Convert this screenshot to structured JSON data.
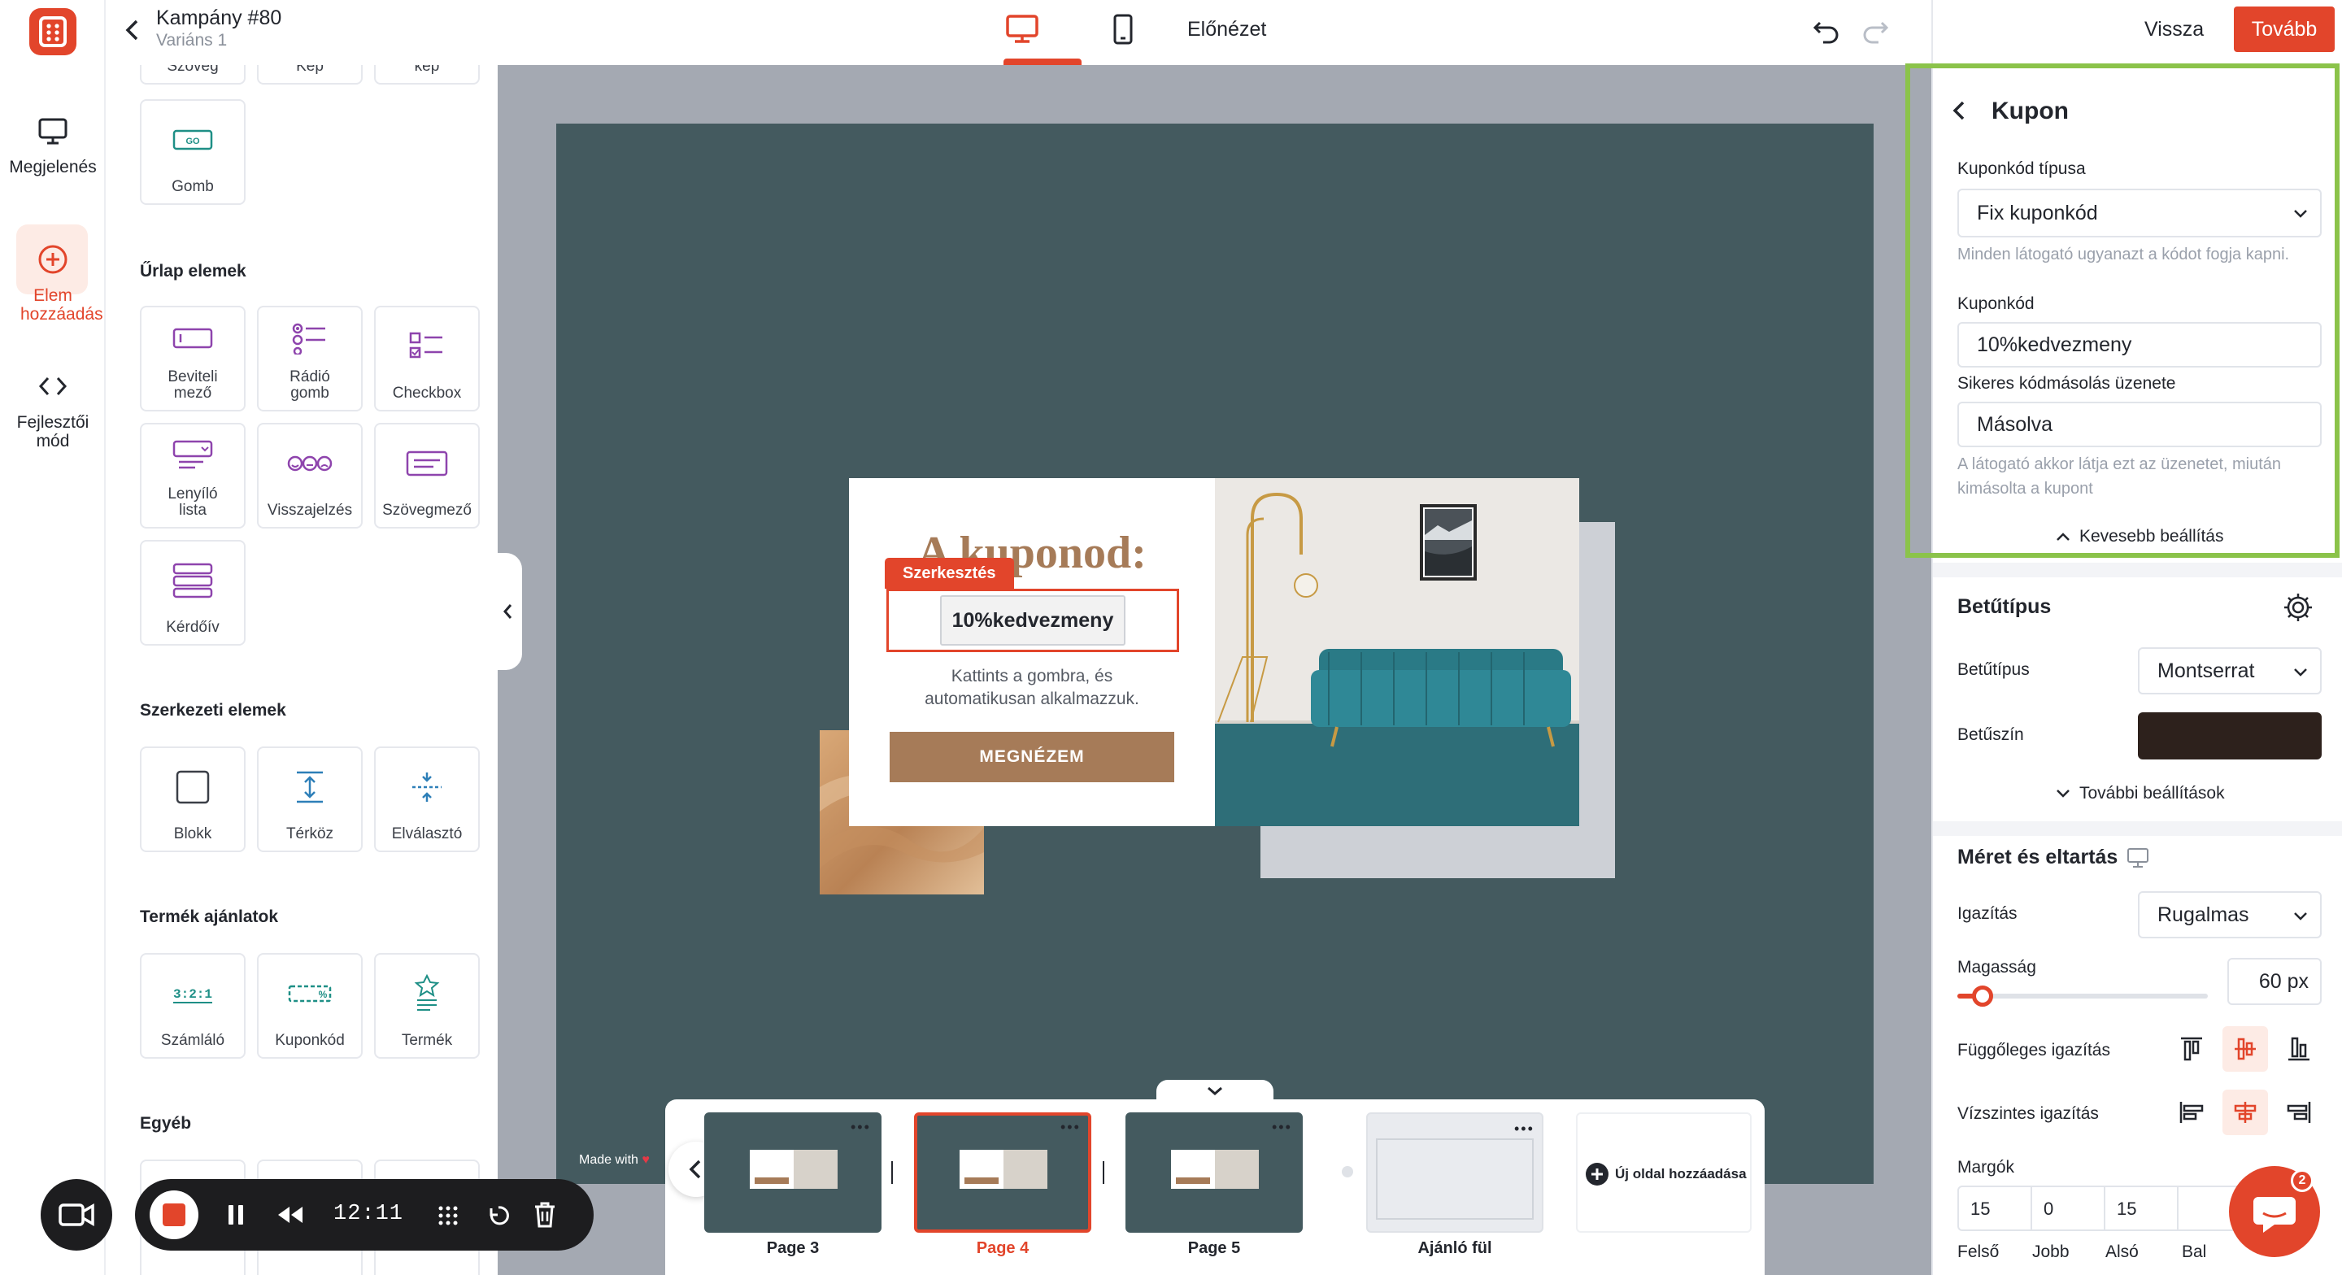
{
  "topbar": {
    "campaign_title": "Kampány #80",
    "variant": "Variáns 1",
    "preview": "Előnézet",
    "back": "Vissza",
    "next": "Tovább"
  },
  "rail": {
    "appearance": "Megjelenés",
    "add_element": "Elem hozzáadás",
    "dev_mode": "Fejlesztői mód"
  },
  "panel": {
    "cut_labels": [
      "Szöveg",
      "Kép",
      "kép"
    ],
    "button_tile": "Gomb",
    "button_chip": "GO",
    "sections": {
      "form": "Űrlap elemek",
      "structure": "Szerkezeti elemek",
      "product": "Termék ajánlatok",
      "other": "Egyéb"
    },
    "form_items": [
      "Beviteli mező",
      "Rádió gomb",
      "Checkbox",
      "Lenyíló lista",
      "Visszajelzés",
      "Szövegmező",
      "Kérdőív"
    ],
    "structure_items": [
      "Blokk",
      "Térköz",
      "Elválasztó"
    ],
    "product_items": [
      "Számláló",
      "Kuponkód",
      "Termék"
    ],
    "counter_chip": "3:2:1"
  },
  "popup": {
    "headline": "A kuponod:",
    "edit_tag": "Szerkesztés",
    "coupon": "10%kedvezmeny",
    "body": "Kattints a gombra, és automatikusan alkalmazzuk.",
    "cta": "MEGNÉZEM"
  },
  "rightpanel": {
    "section_title": "Kupon",
    "type_label": "Kuponkód típusa",
    "type_value": "Fix kuponkód",
    "type_hint": "Minden látogató ugyanazt a kódot fogja kapni.",
    "code_label": "Kuponkód",
    "code_value": "10%kedvezmeny",
    "copy_label": "Sikeres kódmásolás üzenete",
    "copy_value": "Másolva",
    "copy_hint": "A látogató akkor látja ezt az üzenetet, miután kimásolta a kupont",
    "less_settings": "Kevesebb beállítás",
    "font_section": "Betűtípus",
    "font_label": "Betűtípus",
    "font_value": "Montserrat",
    "color_label": "Betűszín",
    "font_color": "#2d211c",
    "more_settings": "További beállítások",
    "size_section": "Méret és eltartás",
    "align_label": "Igazítás",
    "align_value": "Rugalmas",
    "height_label": "Magasság",
    "height_value": "60 px",
    "height_fraction": 0.1,
    "valign_label": "Függőleges igazítás",
    "halign_label": "Vízszintes igazítás",
    "margins_label": "Margók",
    "margins": [
      {
        "value": "15",
        "label": "Felső"
      },
      {
        "value": "0",
        "label": "Jobb"
      },
      {
        "value": "15",
        "label": "Alsó"
      },
      {
        "value": "",
        "label": "Bal"
      }
    ],
    "chat_badge": "2"
  },
  "pages": {
    "made_with": "Made with",
    "items": [
      {
        "label": "Page 3",
        "active": false
      },
      {
        "label": "Page 4",
        "active": true
      },
      {
        "label": "Page 5",
        "active": false
      },
      {
        "label": "Ajánló fül",
        "active": false
      }
    ],
    "add_page": "Új oldal hozzáadása",
    "thumb_title": "A kuponod:",
    "thumb_coupon": "10%kedvezmeny"
  },
  "recorder": {
    "time": "12:11"
  },
  "colors": {
    "accent": "#e2452b",
    "highlight_border": "#8bc34a",
    "stage": "#445a5f",
    "cta": "#a67b58",
    "form_icon": "#8e44ad",
    "product_icon": "#1e8f86"
  }
}
